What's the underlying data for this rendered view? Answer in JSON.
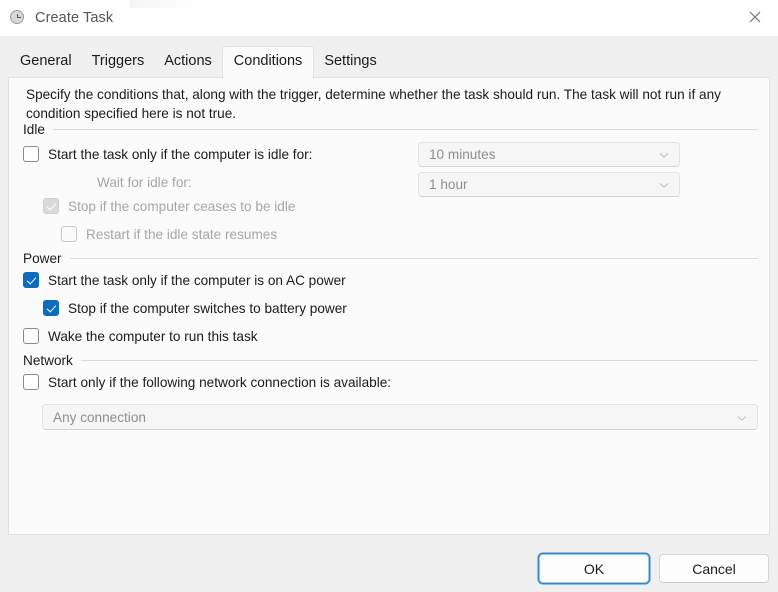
{
  "window": {
    "title": "Create Task",
    "icon": "clock-icon",
    "close_icon": "close-icon"
  },
  "tabs": [
    {
      "label": "General",
      "selected": false
    },
    {
      "label": "Triggers",
      "selected": false
    },
    {
      "label": "Actions",
      "selected": false
    },
    {
      "label": "Conditions",
      "selected": true
    },
    {
      "label": "Settings",
      "selected": false
    }
  ],
  "description": "Specify the conditions that, along with the trigger, determine whether the task should run.  The task will not run  if any condition specified here is not true.",
  "groups": {
    "idle": {
      "title": "Idle",
      "start_if_idle": {
        "label": "Start the task only if the computer is idle for:",
        "checked": false,
        "disabled": false
      },
      "idle_duration": {
        "value": "10 minutes",
        "disabled": true
      },
      "wait_for_idle_label": "Wait for idle for:",
      "wait_duration": {
        "value": "1 hour",
        "disabled": true
      },
      "stop_if_ceases": {
        "label": "Stop if the computer ceases to be idle",
        "checked": true,
        "disabled": true
      },
      "restart_if_resumes": {
        "label": "Restart if the idle state resumes",
        "checked": false,
        "disabled": true
      }
    },
    "power": {
      "title": "Power",
      "ac_power": {
        "label": "Start the task only if the computer is on AC power",
        "checked": true,
        "disabled": false
      },
      "stop_on_battery": {
        "label": "Stop if the computer switches to battery power",
        "checked": true,
        "disabled": false
      },
      "wake_computer": {
        "label": "Wake the computer to run this task",
        "checked": false,
        "disabled": false
      }
    },
    "network": {
      "title": "Network",
      "start_if_network": {
        "label": "Start only if the following network connection is available:",
        "checked": false,
        "disabled": false
      },
      "connection": {
        "value": "Any connection",
        "disabled": true
      }
    }
  },
  "footer": {
    "ok_label": "OK",
    "cancel_label": "Cancel"
  },
  "colors": {
    "accent": "#0f6cbd",
    "focus_ring": "#2f86d6",
    "panel_bg": "#fbfbfb",
    "window_bg": "#f0f0f0",
    "disabled_text": "#a6a6a6"
  }
}
